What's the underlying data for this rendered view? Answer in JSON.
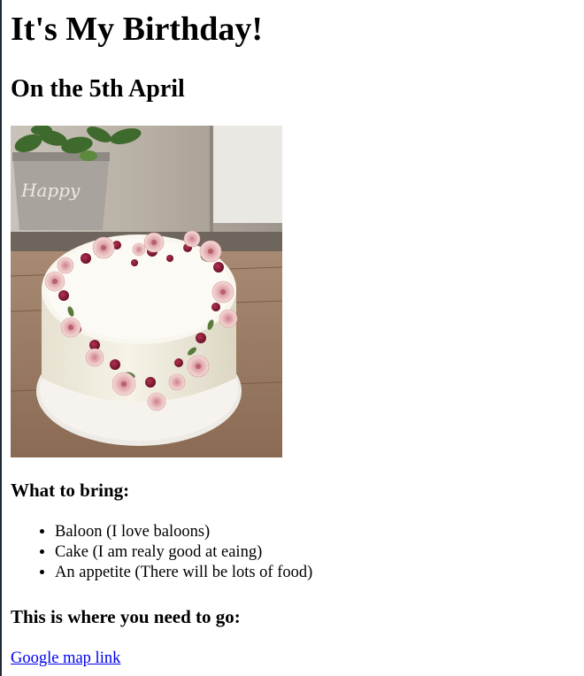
{
  "page": {
    "title": "It's My Birthday!",
    "date_heading": "On the 5th April"
  },
  "cake_photo": {
    "plant_pot_text": "Happy"
  },
  "bring_section": {
    "heading": "What to bring:",
    "items": [
      "Baloon (I love baloons)",
      "Cake (I am realy good at eaing)",
      "An appetite (There will be lots of food)"
    ]
  },
  "location_section": {
    "heading": "This is where you need to go:",
    "link_text": "Google map link"
  },
  "colors": {
    "link": "#0000ee",
    "text": "#000000",
    "background": "#ffffff"
  }
}
